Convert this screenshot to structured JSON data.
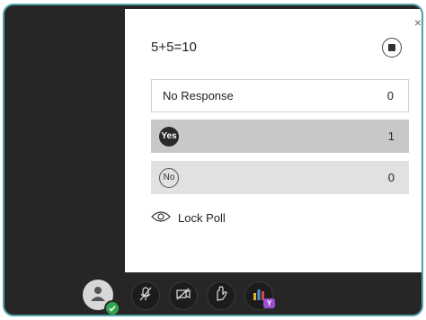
{
  "poll": {
    "question": "5+5=10",
    "close_label": "×",
    "options": [
      {
        "label": "No Response",
        "count": "0"
      },
      {
        "label": "Yes",
        "count": "1",
        "selected": true
      },
      {
        "label": "No",
        "count": "0"
      }
    ],
    "lock_label": "Lock Poll"
  },
  "toolbar": {
    "items": [
      {
        "icon": "avatar-icon",
        "status": "green-check"
      },
      {
        "icon": "microphone-off-icon"
      },
      {
        "icon": "camera-off-icon"
      },
      {
        "icon": "raise-hand-icon"
      },
      {
        "icon": "poll-chart-icon",
        "badge": "Y"
      }
    ]
  },
  "colors": {
    "frame_border": "#4fa3a7",
    "background": "#262626",
    "selected_option": "#c8c8c8",
    "option_bg": "#e1e1e1",
    "status_green": "#2ea44f",
    "badge_purple": "#9b4fd1"
  }
}
